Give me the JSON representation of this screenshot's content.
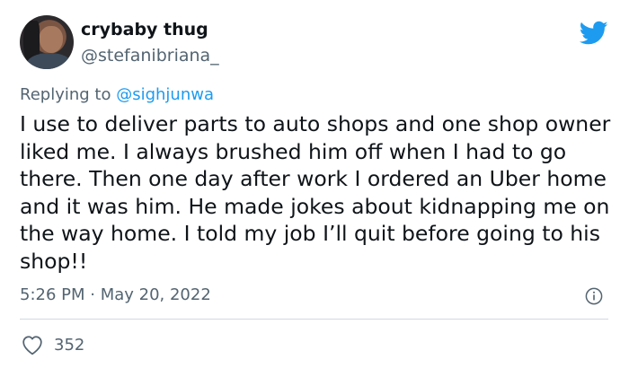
{
  "author": {
    "display_name": "crybaby thug",
    "handle": "@stefanibriana_"
  },
  "reply": {
    "prefix": "Replying to ",
    "mention": "@sighjunwa"
  },
  "tweet": {
    "text": "I use to deliver parts to auto shops and one shop owner liked me. I always brushed him off when I had to go there. Then one day after work I ordered an Uber home and it was him. He made jokes about kidnapping me on the way home. I told my job I’ll quit before going to his shop!!",
    "timestamp": "5:26 PM · May 20, 2022"
  },
  "engagement": {
    "likes": "352"
  },
  "icons": {
    "brand": "twitter-bird-icon",
    "info": "info-icon",
    "like": "heart-icon"
  },
  "colors": {
    "brand_blue": "#1d9bf0",
    "secondary_text": "#536471",
    "primary_text": "#0f1419",
    "divider": "#cfd9de"
  }
}
